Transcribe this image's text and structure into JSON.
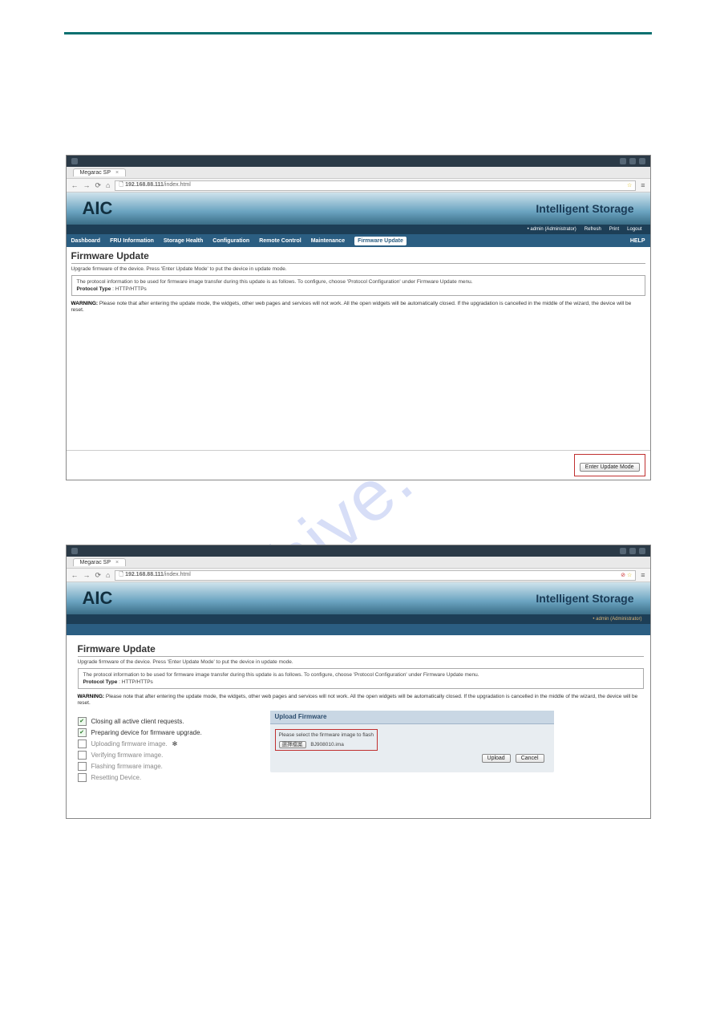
{
  "browser": {
    "tab_title": "Megarac SP",
    "url_host": "192.168.88.111",
    "url_path": "/index.html"
  },
  "app": {
    "logo_text": "AIC",
    "tagline": "Intelligent Storage"
  },
  "userbar": {
    "user": "admin",
    "role": "(Administrator)",
    "refresh": "Refresh",
    "print": "Print",
    "logout": "Logout"
  },
  "nav": {
    "items": [
      "Dashboard",
      "FRU Information",
      "Storage Health",
      "Configuration",
      "Remote Control",
      "Maintenance",
      "Firmware Update"
    ],
    "help": "HELP"
  },
  "screenshot1": {
    "title": "Firmware Update",
    "subdesc": "Upgrade firmware of the device. Press 'Enter Update Mode' to put the device in update mode.",
    "infobox_text": "The protocol information to be used for firmware image transfer during this update is as follows. To configure, choose 'Protocol Configuration' under Firmware Update menu.",
    "protocol_label": "Protocol Type",
    "protocol_value": ": HTTP/HTTPs",
    "warning_label": "WARNING:",
    "warning_text": "Please note that after entering the update mode, the widgets, other web pages and services will not work. All the open widgets will be automatically closed. If the upgradation is cancelled in the middle of the wizard, the device will be reset.",
    "enter_update_mode": "Enter Update Mode"
  },
  "screenshot2": {
    "title": "Firmware Update",
    "subdesc": "Upgrade firmware of the device. Press 'Enter Update Mode' to put the device in update mode.",
    "user_line": "• admin (Administrator)",
    "infobox_text": "The protocol information to be used for firmware image transfer during this update is as follows. To configure, choose 'Protocol Configuration' under Firmware Update menu.",
    "protocol_label": "Protocol Type",
    "protocol_value": ": HTTP/HTTPs",
    "warning_label": "WARNING:",
    "warning_text": "Please note that after entering the update mode, the widgets, other web pages and services will not work. All the open widgets will be automatically closed. If the upgradation is cancelled in the middle of the wizard, the device will be reset.",
    "status": {
      "s1": "Closing all active client requests.",
      "s2": "Preparing device for firmware upgrade.",
      "s3": "Uploading firmware image.",
      "s4": "Verifying firmware image.",
      "s5": "Flashing firmware image.",
      "s6": "Resetting Device."
    },
    "upload": {
      "header": "Upload Firmware",
      "prompt": "Please select the firmware image to flash",
      "browse_label": "選擇檔案",
      "file_name": "BJ908010.ima",
      "upload_btn": "Upload",
      "cancel_btn": "Cancel"
    }
  },
  "watermark": "alshive.com"
}
